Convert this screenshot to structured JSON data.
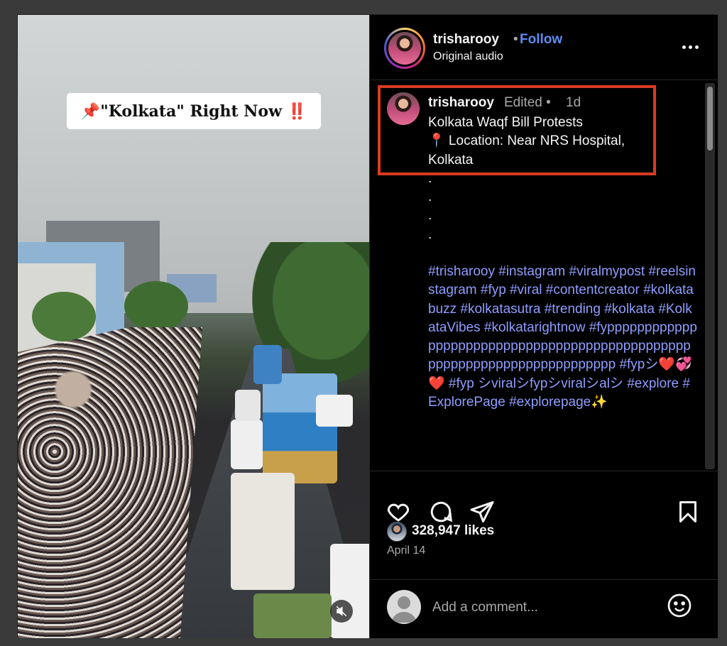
{
  "media": {
    "caption_overlay": "📌\"Kolkata\" Right Now ‼️"
  },
  "header": {
    "username": "trisharooy",
    "separator": "•",
    "follow_label": "Follow",
    "audio_label": "Original audio"
  },
  "caption": {
    "username": "trisharooy",
    "edited_label": "Edited •",
    "time": "1d",
    "body": "Kolkata Waqf Bill Protests\n📍 Location: Near NRS Hospital,\nKolkata\n.\n.\n.\n.",
    "hashtags": "#trisharooy #instagram #viralmypost #reelsinstagram #fyp #viral #contentcreator #kolkatabuzz #kolkatasutra #trending #kolkata #KolkataVibes #kolkatarightnow #fypppppppppppppppppppppppppppppppppppppppppppppppppppppppppppppppppppppppp #fypシ❤️💞❤️ #fyp シviralシfypシviralシalシ #explore #ExplorePage #explorepage✨"
  },
  "actions": {
    "likes": "328,947 likes",
    "date": "April 14"
  },
  "comment": {
    "placeholder": "Add a comment..."
  },
  "colors": {
    "follow": "#5d8cf5",
    "hashtag": "#8f9dff",
    "highlight": "#d93b22"
  },
  "icons": [
    "heart-icon",
    "comment-icon",
    "share-icon",
    "bookmark-icon",
    "more-icon",
    "mute-icon",
    "emoji-icon"
  ]
}
